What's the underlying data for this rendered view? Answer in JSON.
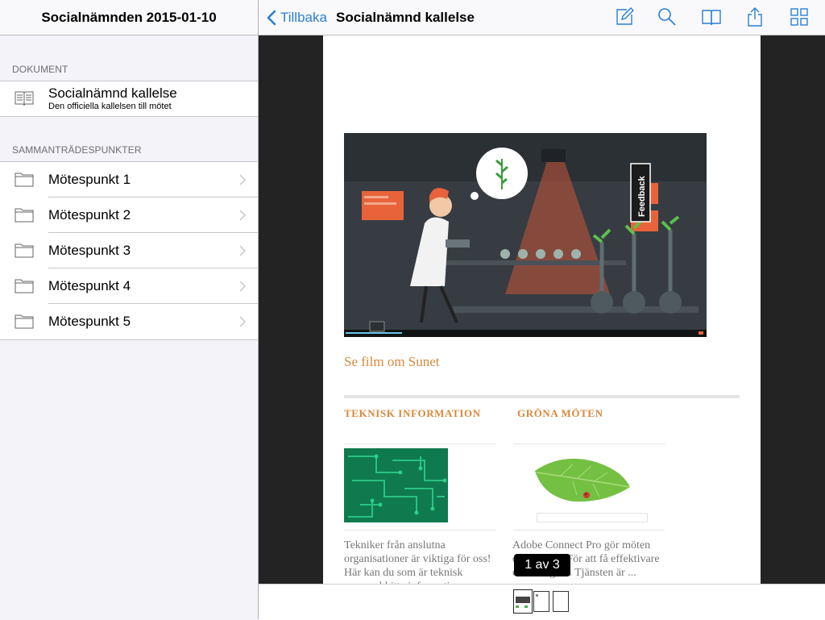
{
  "sidebar": {
    "title": "Socialnämnden 2015-01-10",
    "documents_header": "DOKUMENT",
    "document": {
      "title": "Socialnämnd kallelse",
      "subtitle": "Den officiella kallelsen till mötet",
      "icon": "book-icon"
    },
    "agenda_header": "SAMMANTRÄDESPUNKTER",
    "agenda_items": [
      {
        "label": "Mötespunkt 1",
        "icon": "folder-icon"
      },
      {
        "label": "Mötespunkt 2",
        "icon": "folder-icon"
      },
      {
        "label": "Mötespunkt 3",
        "icon": "folder-icon"
      },
      {
        "label": "Mötespunkt 4",
        "icon": "folder-icon"
      },
      {
        "label": "Mötespunkt 5",
        "icon": "folder-icon"
      }
    ]
  },
  "viewer": {
    "back_label": "Tillbaka",
    "title": "Socialnämnd kallelse",
    "tools": [
      "compose-icon",
      "search-icon",
      "book-icon",
      "share-icon",
      "grid-icon"
    ],
    "accent": "#2a7fd4"
  },
  "page": {
    "video_overlay": "Feedback",
    "film_link": "Se film om Sunet",
    "col1": {
      "heading": "TEKNISK INFORMATION",
      "text": "Tekniker från anslutna organisationer är viktiga för oss! Här kan du som är teknisk personal hitta information om vår..."
    },
    "col2": {
      "heading": "GRÖNA MÖTEN",
      "text": "Adobe Connect Pro gör möten effektivare. För att få effektivare och billigare. Tjänsten är ..."
    },
    "accent": "#d9883a"
  },
  "pager": {
    "label": "1 av 3",
    "current": 1,
    "total": 3
  }
}
